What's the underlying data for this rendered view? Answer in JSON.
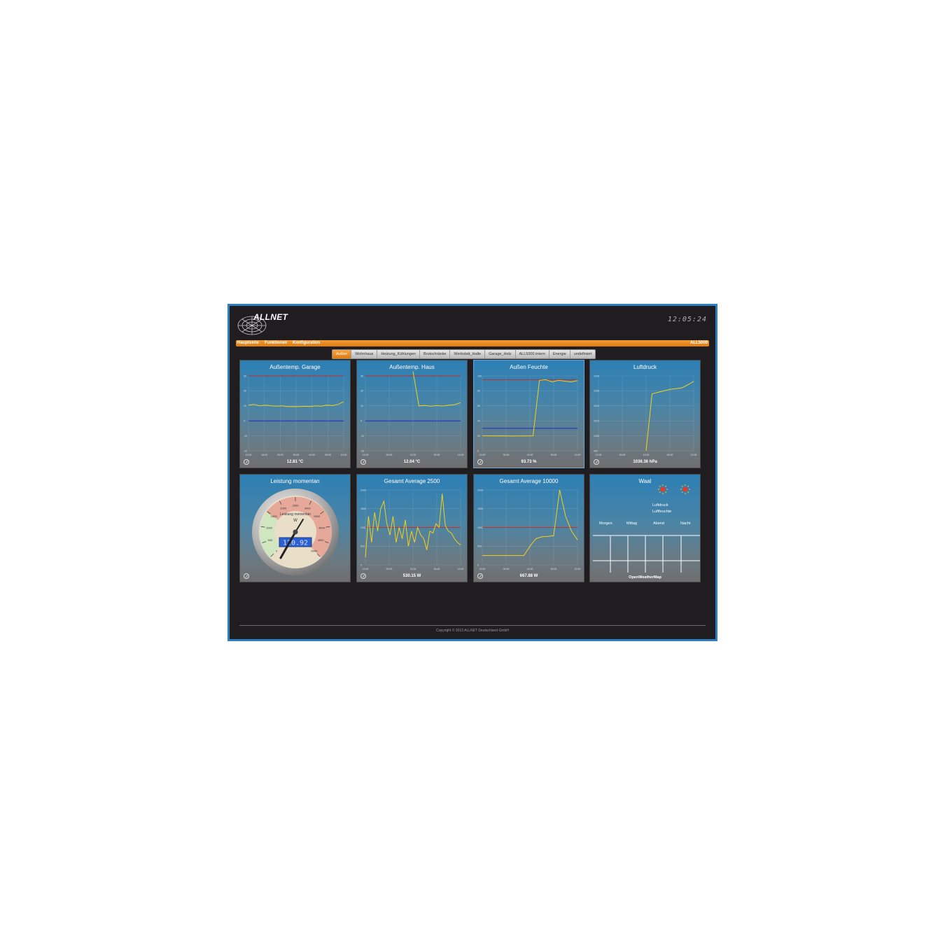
{
  "header": {
    "brand": "ALLNET",
    "clock": "12:05:24"
  },
  "menu": {
    "items": [
      "Hauptseite",
      "Funktionen",
      "Konfiguration"
    ],
    "device": "ALL5000"
  },
  "tabs": [
    {
      "label": "Außen",
      "active": true
    },
    {
      "label": "Wohnhaus"
    },
    {
      "label": "Heizung_Kühlungen"
    },
    {
      "label": "Brutschränke"
    },
    {
      "label": "Werkstatt_Halle"
    },
    {
      "label": "Garage_Holz"
    },
    {
      "label": "ALL5000 intern"
    },
    {
      "label": "Energie"
    },
    {
      "label": "undefiniert"
    }
  ],
  "tiles": [
    {
      "title": "Außentemp. Garage",
      "value": "12.81 °C"
    },
    {
      "title": "Außentemp. Haus",
      "value": "12.04 °C"
    },
    {
      "title": "Außen Feuchte",
      "value": "93.73 %"
    },
    {
      "title": "Luftdruck",
      "value": "1036.36 hPa"
    },
    {
      "title": "Leistung momentan",
      "value": ""
    },
    {
      "title": "Gesamt Average 2500",
      "value": "530.15 W"
    },
    {
      "title": "Gesamt Average 10000",
      "value": "667.88 W"
    },
    {
      "title": "Waal",
      "value": ""
    }
  ],
  "gauge": {
    "label": "Leistung momentan",
    "unit": "W",
    "display": "120.92",
    "ticks": [
      "0",
      "500",
      "1000",
      "1500",
      "2000",
      "2500",
      "3000",
      "3500",
      "4000",
      "4500",
      "5000"
    ]
  },
  "weather": {
    "periods": [
      "Morgen",
      "Mittag",
      "Abend",
      "Nacht"
    ],
    "legend": [
      "Luftdruck",
      "Luftfeuchte"
    ],
    "source": "OpenWeatherMap"
  },
  "footer": {
    "copyright": "Copyright © 2013 ALLNET Deutschland GmbH"
  },
  "colors": {
    "accent": "#e8820e",
    "tile_top": "#2c7fb5",
    "line": "#f2d21a",
    "upper_limit": "#c0302e",
    "lower_limit": "#1a2ec0"
  },
  "chart_data": [
    {
      "type": "line",
      "title": "Außentemp. Garage",
      "x": [
        "12:00",
        "16:00",
        "20:00",
        "00:00",
        "04:00",
        "08:00",
        "12:00"
      ],
      "yticks": [
        "30",
        "20",
        "10",
        "0",
        "-10",
        "-20"
      ],
      "ylim": [
        -20,
        30
      ],
      "series": [
        {
          "values": [
            10.5,
            11,
            10,
            10.5,
            10,
            9.8,
            10,
            9.5,
            9.6,
            9.5,
            9.7,
            9.6,
            10,
            9.8,
            10.5,
            10.2,
            11,
            12.81
          ]
        }
      ],
      "limits": {
        "upper": 30,
        "lower": 0
      }
    },
    {
      "type": "line",
      "title": "Außentemp. Haus",
      "x": [
        "12:00",
        "00:00",
        "12:00",
        "00:00",
        "12:00"
      ],
      "yticks": [
        "30",
        "20",
        "10",
        "0",
        "-10",
        "-20"
      ],
      "ylim": [
        -20,
        30
      ],
      "series": [
        {
          "values": [
            null,
            null,
            null,
            null,
            null,
            null,
            null,
            null,
            33,
            10,
            10.3,
            9.8,
            10.2,
            9.9,
            10.4,
            10.8,
            12.04
          ]
        }
      ],
      "limits": {
        "upper": 30,
        "lower": 0
      }
    },
    {
      "type": "line",
      "title": "Außen Feuchte",
      "x": [
        "12:00",
        "00:00",
        "12:00",
        "00:00",
        "12:00"
      ],
      "yticks": [
        "100",
        "80",
        "60",
        "40",
        "20",
        "0"
      ],
      "ylim": [
        0,
        100
      ],
      "series": [
        {
          "values": [
            20,
            20,
            19.8,
            20,
            19.9,
            19.7,
            19.8,
            19.9,
            20,
            94,
            95,
            92,
            94,
            93,
            92,
            93.73
          ]
        }
      ],
      "limits": {
        "upper": 95,
        "lower": 30
      }
    },
    {
      "type": "line",
      "title": "Luftdruck",
      "x": [
        "12:00",
        "00:00",
        "12:00",
        "00:00",
        "12:00"
      ],
      "yticks": [
        "1040",
        "1030",
        "1020",
        "1010",
        "1000",
        "990"
      ],
      "ylim": [
        990,
        1040
      ],
      "series": [
        {
          "values": [
            null,
            null,
            null,
            null,
            null,
            null,
            null,
            null,
            990,
            1028,
            1029,
            1030,
            1031,
            1031.5,
            1032,
            1034,
            1036.36
          ]
        }
      ]
    },
    {
      "type": "line",
      "title": "Gesamt Average 2500",
      "x": [
        "12:00",
        "00:00",
        "12:00",
        "00:00",
        "12:00"
      ],
      "yticks": [
        "2000",
        "1500",
        "1000",
        "500",
        "0"
      ],
      "ylim": [
        0,
        2000
      ],
      "series": [
        {
          "values": [
            200,
            1300,
            600,
            1400,
            900,
            1500,
            1700,
            1100,
            800,
            1300,
            600,
            1000,
            700,
            1200,
            500,
            900,
            600,
            1000,
            800,
            700,
            400,
            900,
            850,
            1100,
            1000,
            1900,
            1050,
            900,
            850,
            700,
            600,
            530
          ]
        }
      ],
      "limits": {
        "upper": 1000
      }
    },
    {
      "type": "line",
      "title": "Gesamt Average 10000",
      "x": [
        "12:00",
        "00:00",
        "12:00",
        "00:00",
        "12:00"
      ],
      "yticks": [
        "2000",
        "1500",
        "1000",
        "500",
        "0"
      ],
      "ylim": [
        0,
        2000
      ],
      "series": [
        {
          "values": [
            250,
            250,
            250,
            250,
            250,
            250,
            250,
            250,
            500,
            700,
            750,
            760,
            780,
            2000,
            1300,
            900,
            667.88
          ]
        }
      ],
      "limits": {
        "upper": 1000
      }
    }
  ]
}
